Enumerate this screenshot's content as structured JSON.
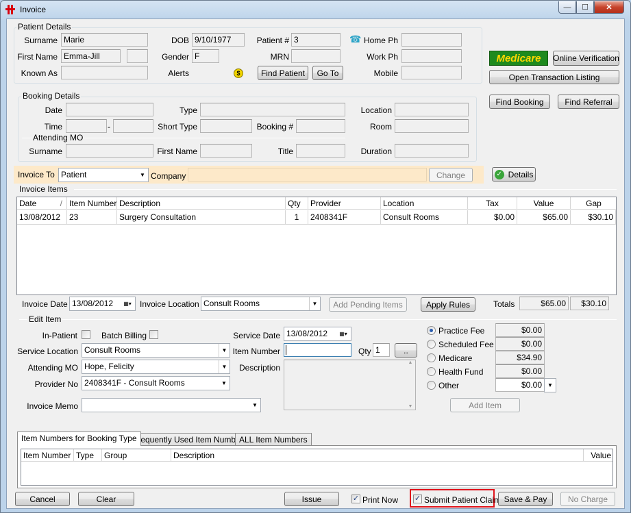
{
  "window": {
    "title": "Invoice",
    "minimize": "—",
    "maximize": "☐",
    "close": "✕"
  },
  "patient_details": {
    "label": "Patient Details",
    "surname_label": "Surname",
    "surname": "Marie",
    "dob_label": "DOB",
    "dob": "9/10/1977",
    "patient_no_label": "Patient #",
    "patient_no": "3",
    "home_ph_label": "Home Ph",
    "home_ph": "",
    "first_name_label": "First Name",
    "first_name": "Emma-Jill",
    "gender_label": "Gender",
    "gender": "F",
    "mrn_label": "MRN",
    "mrn": "",
    "work_ph_label": "Work Ph",
    "work_ph": "",
    "known_as_label": "Known As",
    "known_as": "",
    "alerts_label": "Alerts",
    "mobile_label": "Mobile",
    "mobile": "",
    "find_patient": "Find Patient",
    "go_to": "Go To"
  },
  "medicare": {
    "logo": "Medicare",
    "online_verification": "Online Verification",
    "open_transaction_listing": "Open Transaction Listing"
  },
  "booking_details": {
    "label": "Booking Details",
    "date_label": "Date",
    "type_label": "Type",
    "location_label": "Location",
    "time_label": "Time",
    "time_dash": "-",
    "short_type_label": "Short Type",
    "booking_no_label": "Booking #",
    "room_label": "Room",
    "attending_mo_label": "Attending MO",
    "surname_label": "Surname",
    "first_name_label": "First Name",
    "title_label": "Title",
    "duration_label": "Duration",
    "find_booking": "Find Booking",
    "find_referral": "Find Referral"
  },
  "invoice_to": {
    "label": "Invoice To",
    "value": "Patient",
    "company_label": "Company",
    "company": "",
    "change": "Change",
    "details": "Details"
  },
  "invoice_items": {
    "label": "Invoice Items",
    "columns": [
      "Date",
      "Item Number",
      "Description",
      "Qty",
      "Provider",
      "Location",
      "Tax",
      "Value",
      "Gap"
    ],
    "sort_marker": "/",
    "rows": [
      [
        "13/08/2012",
        "23",
        "Surgery Consultation",
        "1",
        "2408341F",
        "Consult Rooms",
        "$0.00",
        "$65.00",
        "$30.10"
      ]
    ]
  },
  "invoice_footer": {
    "invoice_date_label": "Invoice Date",
    "invoice_date": "13/08/2012",
    "invoice_location_label": "Invoice Location",
    "invoice_location": "Consult Rooms",
    "add_pending_items": "Add Pending Items",
    "apply_rules": "Apply Rules",
    "totals_label": "Totals",
    "total_value": "$65.00",
    "total_gap": "$30.10"
  },
  "edit_item": {
    "label": "Edit Item",
    "in_patient_label": "In-Patient",
    "batch_billing_label": "Batch Billing",
    "service_location_label": "Service Location",
    "service_location": "Consult Rooms",
    "attending_mo_label": "Attending MO",
    "attending_mo": "Hope, Felicity",
    "provider_no_label": "Provider No",
    "provider_no": "2408341F - Consult Rooms",
    "invoice_memo_label": "Invoice Memo",
    "invoice_memo": "",
    "service_date_label": "Service Date",
    "service_date": "13/08/2012",
    "item_number_label": "Item Number",
    "item_number": "",
    "qty_label": "Qty",
    "qty": "1",
    "ellipsis": "..",
    "description_label": "Description",
    "fees": [
      {
        "label": "Practice Fee",
        "value": "$0.00"
      },
      {
        "label": "Scheduled Fee",
        "value": "$0.00"
      },
      {
        "label": "Medicare",
        "value": "$34.90"
      },
      {
        "label": "Health Fund",
        "value": "$0.00"
      },
      {
        "label": "Other",
        "value": "$0.00"
      }
    ],
    "add_item": "Add Item"
  },
  "item_tabs": {
    "tabs": [
      "Item Numbers for Booking Type",
      "Frequently Used Item Numbers",
      "ALL Item Numbers"
    ],
    "columns": [
      "Item Number",
      "Type",
      "Group",
      "Description",
      "Value"
    ]
  },
  "bottom_bar": {
    "cancel": "Cancel",
    "clear": "Clear",
    "issue": "Issue",
    "print_now": "Print Now",
    "submit_patient_claim": "Submit Patient Claim",
    "save_pay": "Save & Pay",
    "no_charge": "No Charge"
  },
  "colors": {
    "medicare_green": "#1e8a1e",
    "medicare_yellow": "#ffd700",
    "highlight_red": "#e0141c",
    "invoice_to_bg": "#fde9c9"
  },
  "icons": {
    "app": "red-cross-icon",
    "phone": "phone-icon",
    "alerts": "dollar-coin-icon",
    "details": "green-check-icon",
    "calendar": "calendar-icon"
  }
}
